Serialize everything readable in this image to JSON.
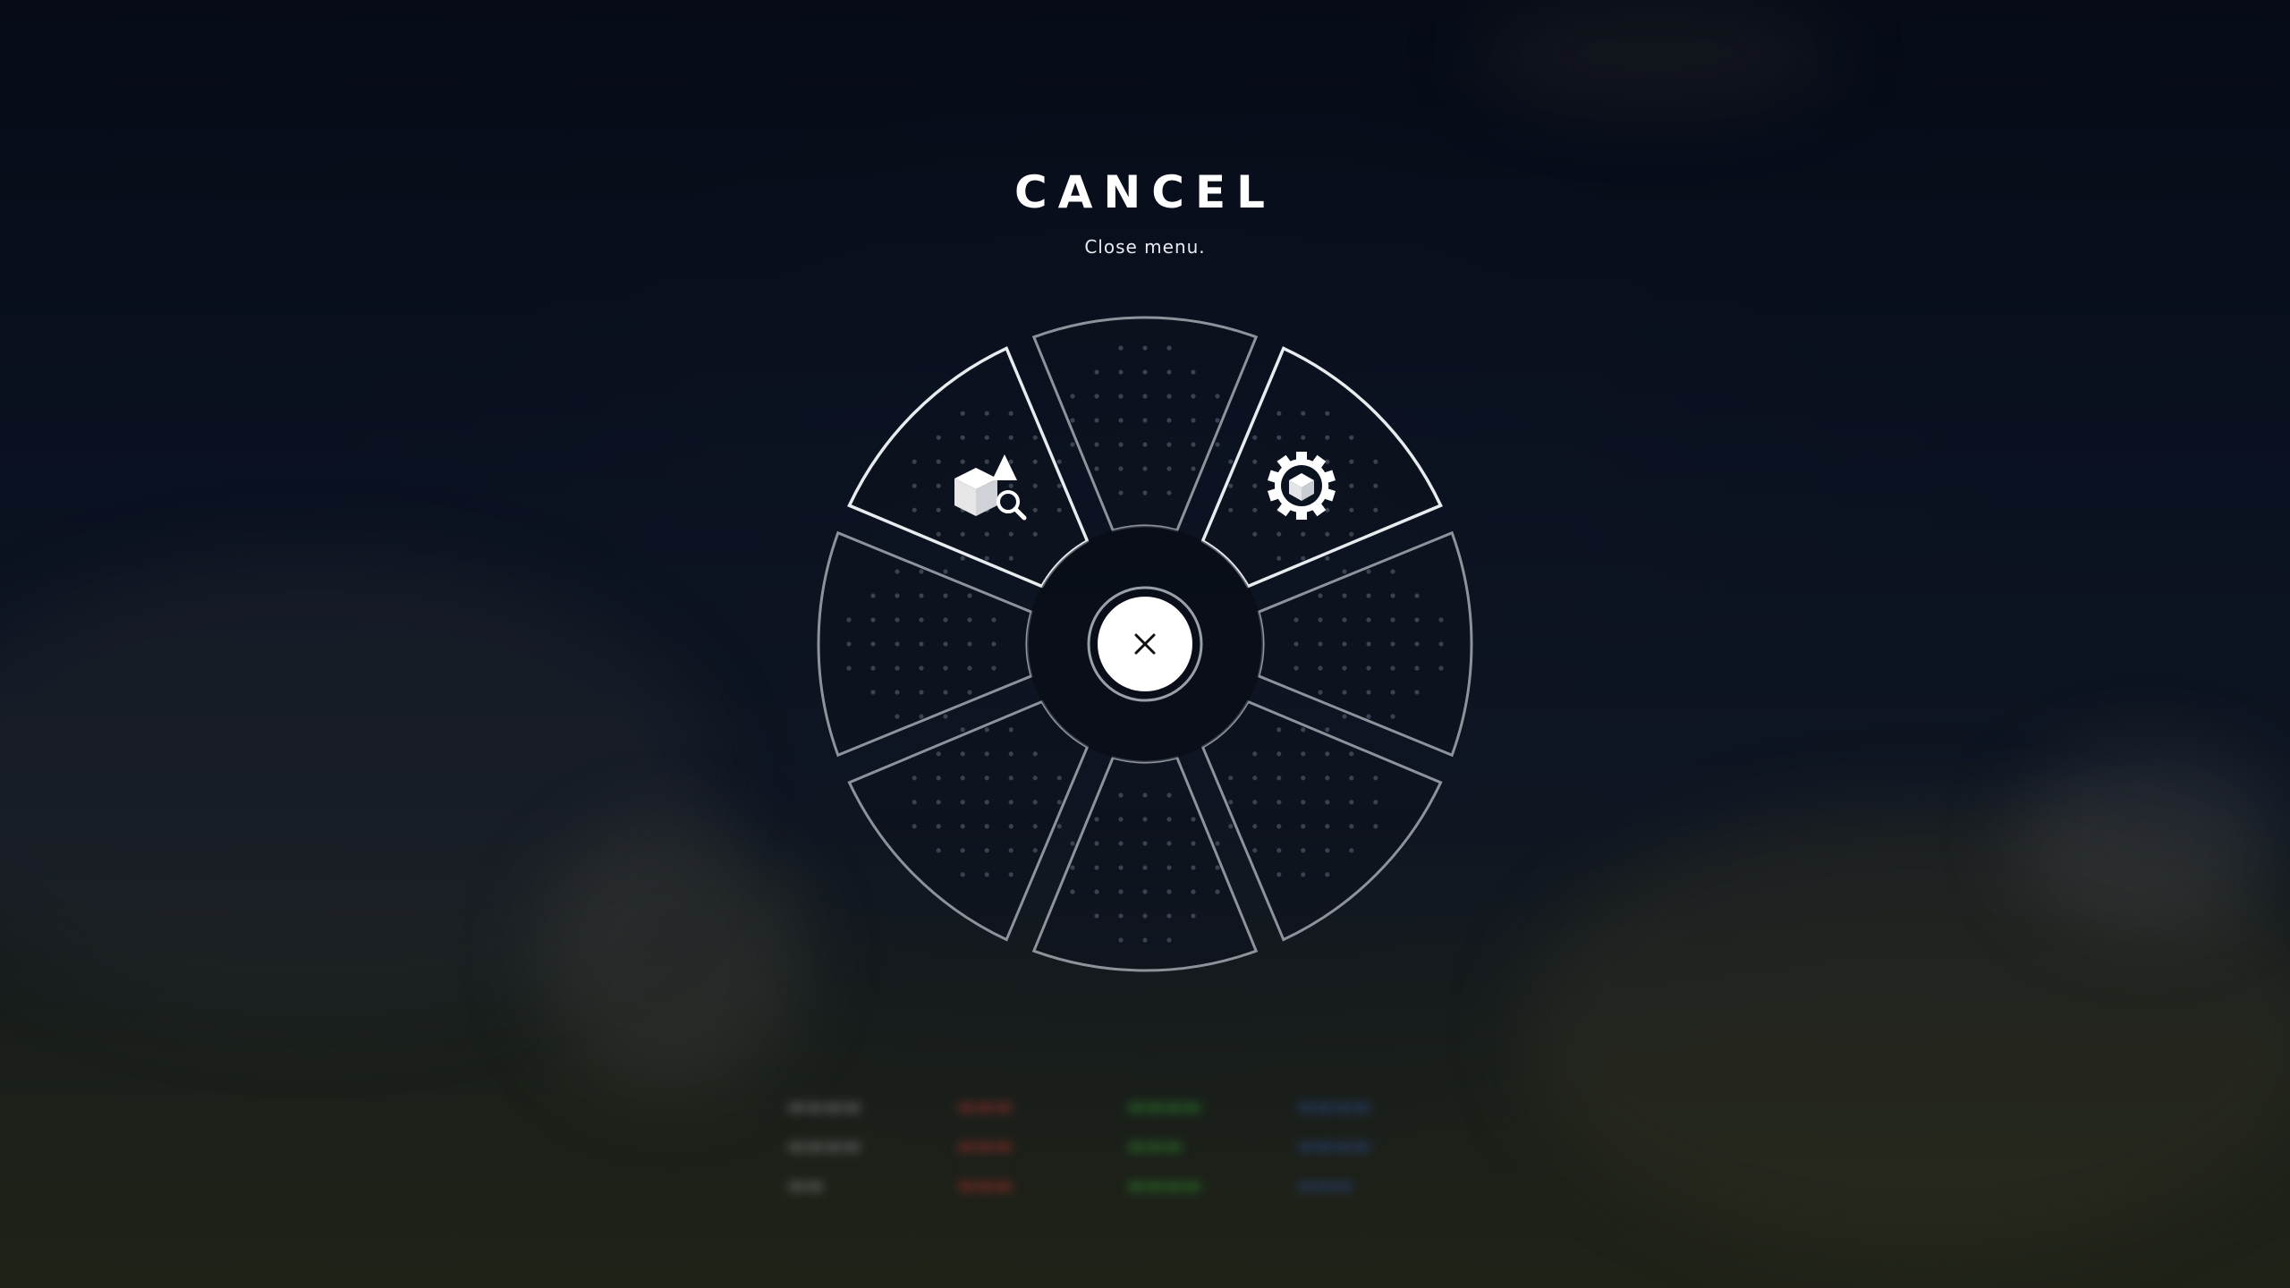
{
  "header": {
    "title": "CANCEL",
    "subtitle": "Close menu."
  },
  "radial_menu": {
    "segments": [
      {
        "id": "top",
        "icon": "empty-slot-icon"
      },
      {
        "id": "top-right",
        "icon": "gear-cube-icon"
      },
      {
        "id": "right",
        "icon": "empty-slot-icon"
      },
      {
        "id": "bottom-right",
        "icon": "empty-slot-icon"
      },
      {
        "id": "bottom",
        "icon": "empty-slot-icon"
      },
      {
        "id": "bottom-left",
        "icon": "empty-slot-icon"
      },
      {
        "id": "left",
        "icon": "empty-slot-icon"
      },
      {
        "id": "top-left",
        "icon": "object-inspect-icon"
      }
    ],
    "center": {
      "icon": "close-icon"
    }
  },
  "colors": {
    "background": "#050a14",
    "ring_stroke": "#8e939b",
    "ring_highlight": "#e9ecef",
    "center_fill": "#ffffff",
    "icon_color": "#ffffff"
  }
}
